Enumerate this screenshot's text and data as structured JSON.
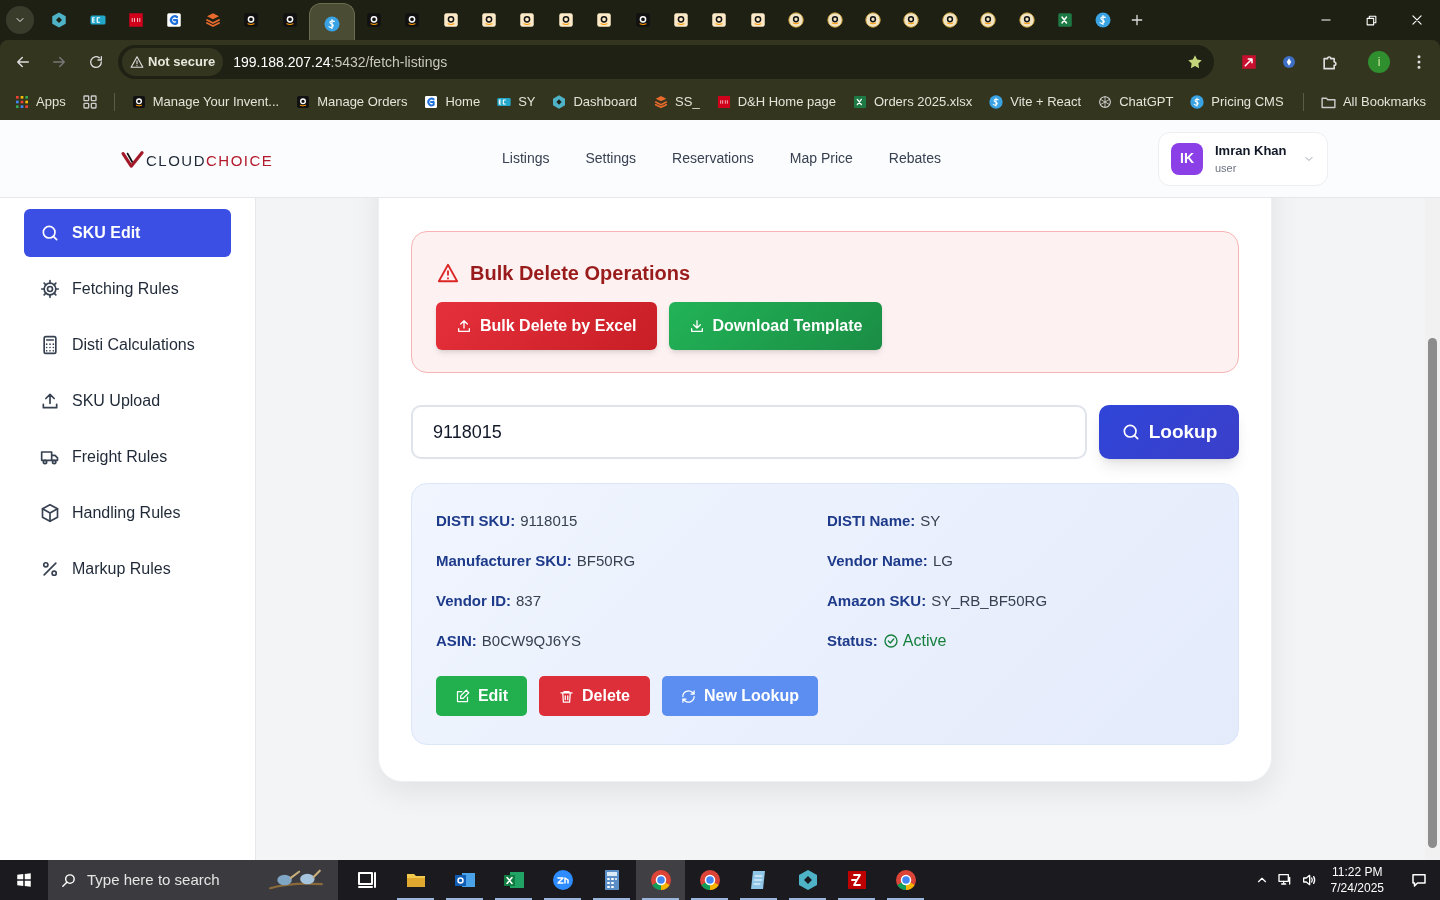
{
  "browser": {
    "tabs": [
      {
        "kind": "hex",
        "selected": false
      },
      {
        "kind": "ec",
        "selected": false
      },
      {
        "kind": "dh",
        "selected": false
      },
      {
        "kind": "g",
        "selected": false
      },
      {
        "kind": "ss",
        "selected": false
      },
      {
        "kind": "amazon",
        "selected": false
      },
      {
        "kind": "amazon",
        "selected": false
      },
      {
        "kind": "dollar",
        "selected": true
      },
      {
        "kind": "amazon",
        "selected": false
      },
      {
        "kind": "amazon",
        "selected": false
      },
      {
        "kind": "amazon-light",
        "selected": false
      },
      {
        "kind": "amazon-light",
        "selected": false
      },
      {
        "kind": "amazon-light",
        "selected": false
      },
      {
        "kind": "amazon-light",
        "selected": false
      },
      {
        "kind": "amazon-light",
        "selected": false
      },
      {
        "kind": "amazon",
        "selected": false
      },
      {
        "kind": "amazon-light",
        "selected": false
      },
      {
        "kind": "amazon-light",
        "selected": false
      },
      {
        "kind": "amazon-light",
        "selected": false
      },
      {
        "kind": "amazon-round",
        "selected": false
      },
      {
        "kind": "amazon-round",
        "selected": false
      },
      {
        "kind": "amazon-round",
        "selected": false
      },
      {
        "kind": "amazon-round",
        "selected": false
      },
      {
        "kind": "amazon-round",
        "selected": false
      },
      {
        "kind": "amazon-round",
        "selected": false
      },
      {
        "kind": "amazon-round",
        "selected": false
      },
      {
        "kind": "excel",
        "selected": false
      },
      {
        "kind": "dollar",
        "selected": false
      }
    ],
    "security": "Not secure",
    "url_host": "199.188.207.24",
    "url_rest": ":5432/fetch-listings",
    "bookmarks": [
      {
        "kind": "apps",
        "label": "Apps"
      },
      {
        "kind": "grid"
      },
      {
        "kind": "amazon",
        "label": "Manage Your Invent..."
      },
      {
        "kind": "amazon",
        "label": "Manage Orders"
      },
      {
        "kind": "g",
        "label": "Home"
      },
      {
        "kind": "ec",
        "label": "SY"
      },
      {
        "kind": "hex",
        "label": "Dashboard"
      },
      {
        "kind": "ss",
        "label": "SS_"
      },
      {
        "kind": "dh",
        "label": "D&H Home page"
      },
      {
        "kind": "excel",
        "label": "Orders 2025.xlsx"
      },
      {
        "kind": "dollar",
        "label": "Vite + React"
      },
      {
        "kind": "chatgpt",
        "label": "ChatGPT"
      },
      {
        "kind": "dollar",
        "label": "Pricing CMS"
      }
    ],
    "all_bookmarks": "All Bookmarks",
    "profile_initial": "i"
  },
  "header": {
    "logo_a": "CLOUD",
    "logo_b": "CHOICE",
    "nav": [
      "Listings",
      "Settings",
      "Reservations",
      "Map Price",
      "Rebates"
    ],
    "user": {
      "initials": "IK",
      "name": "Imran Khan",
      "role": "user"
    }
  },
  "sidebar": {
    "items": [
      {
        "kind": "search",
        "label": "SKU Edit",
        "selected": true
      },
      {
        "kind": "gear",
        "label": "Fetching Rules",
        "selected": false
      },
      {
        "kind": "calculator",
        "label": "Disti Calculations",
        "selected": false
      },
      {
        "kind": "upload",
        "label": "SKU Upload",
        "selected": false
      },
      {
        "kind": "truck",
        "label": "Freight Rules",
        "selected": false
      },
      {
        "kind": "package",
        "label": "Handling Rules",
        "selected": false
      },
      {
        "kind": "percent",
        "label": "Markup Rules",
        "selected": false
      }
    ]
  },
  "bulk_delete": {
    "title": "Bulk Delete Operations",
    "buttons": [
      {
        "kind": "upload",
        "label": "Bulk Delete by Excel"
      },
      {
        "kind": "download",
        "label": "Download Template"
      }
    ]
  },
  "lookup": {
    "value": "9118015",
    "button": "Lookup"
  },
  "result": {
    "fields": [
      {
        "label": "DISTI SKU:",
        "value": "9118015"
      },
      {
        "label": "DISTI Name:",
        "value": "SY"
      },
      {
        "label": "Manufacturer SKU:",
        "value": "BF50RG"
      },
      {
        "label": "Vendor Name:",
        "value": "LG"
      },
      {
        "label": "Vendor ID:",
        "value": "837"
      },
      {
        "label": "Amazon SKU:",
        "value": "SY_RB_BF50RG"
      },
      {
        "label": "ASIN:",
        "value": "B0CW9QJ6YS"
      },
      {
        "label": "Status:",
        "value": "Active",
        "kind": "status"
      }
    ],
    "buttons": [
      {
        "kind": "edit",
        "label": "Edit"
      },
      {
        "kind": "delete",
        "label": "Delete"
      },
      {
        "kind": "refresh",
        "label": "New Lookup"
      }
    ]
  },
  "taskbar": {
    "search_placeholder": "Type here to search",
    "apps": [
      {
        "kind": "taskview",
        "selected": false
      },
      {
        "kind": "folder",
        "selected": false
      },
      {
        "kind": "outlook",
        "selected": false
      },
      {
        "kind": "excel",
        "selected": false
      },
      {
        "kind": "zoom",
        "selected": false
      },
      {
        "kind": "calculator",
        "selected": false
      },
      {
        "kind": "chrome",
        "selected": true
      },
      {
        "kind": "chrome",
        "selected": false
      },
      {
        "kind": "notes",
        "selected": false
      },
      {
        "kind": "hex",
        "selected": false
      },
      {
        "kind": "filezilla",
        "selected": false
      },
      {
        "kind": "chrome",
        "selected": false
      }
    ],
    "time": "11:22 PM",
    "date": "7/24/2025"
  }
}
